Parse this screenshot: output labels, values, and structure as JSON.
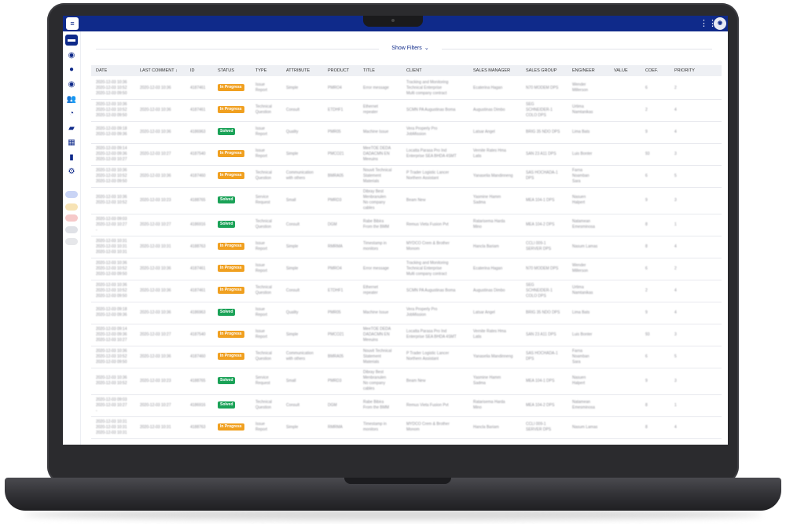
{
  "colors": {
    "brand": "#0f2a8a",
    "in_progress": "#f0a020",
    "solved": "#1aa257",
    "header_bg": "#eef0f4"
  },
  "topbar": {
    "logo_icon": "app-logo-icon",
    "apps_icon": "grid-apps-icon",
    "avatar_icon": "user-avatar"
  },
  "sidebar": {
    "items": [
      {
        "icon": "dashboard-icon",
        "active": true
      },
      {
        "icon": "eye-icon"
      },
      {
        "icon": "circle-icon"
      },
      {
        "icon": "eye-outline-icon"
      },
      {
        "icon": "users-icon"
      },
      {
        "icon": "clock-icon"
      },
      {
        "icon": "truck-icon"
      },
      {
        "icon": "qr-grid-icon"
      },
      {
        "icon": "document-icon"
      },
      {
        "icon": "settings-gear-icon"
      }
    ],
    "badges": [
      {
        "color": "#c9d4f5"
      },
      {
        "color": "#f7e3b5"
      },
      {
        "color": "#f6c9c9"
      },
      {
        "color": "#dfe1e6"
      },
      {
        "color": "#e6e7ea"
      }
    ]
  },
  "filters": {
    "label": "Show Filters"
  },
  "table": {
    "columns": [
      "DATE",
      "LAST COMMENT",
      "ID",
      "STATUS",
      "TYPE",
      "ATTRIBUTE",
      "PRODUCT",
      "TITLE",
      "CLIENT",
      "SALES MANAGER",
      "SALES GROUP",
      "ENGINEER",
      "VALUE",
      "COEF.",
      "PRIORITY"
    ],
    "sort_indicator": "↓",
    "rows": [
      {
        "date": "2020-12-03 10:36\n2020-12-03 10:52\n2020-12-03 09:50",
        "last": "2020-12-03 10:36",
        "id": "4187461",
        "status": "In Progress",
        "type": "Issue\nReport",
        "attr": "Simple",
        "product": "PMRO4",
        "title": "Error message",
        "client": "Tracking and Monitoring\nTechnical Enterprise\nMulti company contract",
        "sm": "Ecaterina Hagan",
        "sg": "N70 MODEM DPS",
        "eng": "Wender\nMillerson",
        "value": "",
        "coef": "6",
        "prio": "2"
      },
      {
        "date": "2020-12-03 10:36\n2020-12-03 10:52\n2020-12-03 09:50",
        "last": "2020-12-03 10:36",
        "id": "4187461",
        "status": "In Progress",
        "type": "Technical\nQuestion",
        "attr": "Consult",
        "product": "ETDHF1",
        "title": "Ethernet\nrepeater",
        "client": "SCMN PA Augustinas Boma",
        "sm": "Augustinas Dimbo",
        "sg": "SEG\nSCHNEIDER-1\nCOLO DPS",
        "eng": "Urtima\nNamtanikas",
        "value": "",
        "coef": "2",
        "prio": "4"
      },
      {
        "date": "2020-12-03 09:18\n2020-12-03 09:36",
        "last": "2020-12-03 10:36",
        "id": "4186963",
        "status": "Solved",
        "type": "Issue\nReport",
        "attr": "Quality",
        "product": "PMR05",
        "title": "Machine Issue",
        "client": "Vera Properly Pro\nJobMission",
        "sm": "Latsar Angel",
        "sg": "BRIG 35 NDO DPS",
        "eng": "Lima Bats",
        "value": "",
        "coef": "9",
        "prio": "4"
      },
      {
        "date": "2020-12-03 09:14\n2020-12-03 09:36\n2020-12-03 10:27",
        "last": "2020-12-03 10:27",
        "id": "4187540",
        "status": "In Progress",
        "type": "Issue\nReport",
        "attr": "Simple",
        "product": "PMCO21",
        "title": "MeeTOE DEDA\nDADACMN EN\nMeeuins",
        "client": "Locatta Parasa Pro Ind\nEnterprise SEA BHDA 4SMT",
        "sm": "Vernite Rates Hma\nLatis",
        "sg": "SAN 23 A11 DPS",
        "eng": "Luis Bonter",
        "value": "",
        "coef": "93",
        "prio": "3"
      },
      {
        "date": "2020-12-03 10:36\n2020-12-03 10:52\n2020-12-03 09:50",
        "last": "2020-12-03 10:36",
        "id": "4187460",
        "status": "In Progress",
        "type": "Technical\nQuestion",
        "attr": "Communication\nwith others",
        "product": "BMRA05",
        "title": "Nouvit Technical\nStatement\nMaterials",
        "client": "P Trader Logistic Lancer\nNorthern Assistant",
        "sm": "Yanaselia Mandinneng",
        "sg": "SAS HOCHADA-1\nDPS",
        "eng": "Farna\nNoamban\nSara",
        "value": "",
        "coef": "6",
        "prio": "5"
      },
      {
        "date": "2020-12-03 10:36\n2020-12-03 10:52",
        "last": "2020-12-03 10:23",
        "id": "4188765",
        "status": "Solved",
        "type": "Service\nRequest",
        "attr": "Small",
        "product": "PMRD3",
        "title": "Dibray Best\nMenbranulen\nNo company\ncables",
        "client": "Beam New",
        "sm": "Yasmine Hamm\nSadma",
        "sg": "MEA 104-1 DPS",
        "eng": "Nasuen\nHalpert",
        "value": "",
        "coef": "9",
        "prio": "3"
      },
      {
        "date": "2020-12-03 09:03\n2020-12-03 10:27\n-",
        "last": "2020-12-03 10:27",
        "id": "4186916",
        "status": "Solved",
        "type": "Technical\nQuestion",
        "attr": "Consult",
        "product": "DGM",
        "title": "Rabe Bibira\nFrom the BMM",
        "client": "Remus Vieta Fusion Pvt",
        "sm": "Ratarisema Harda\nMino",
        "sg": "MEA 104-2 DPS",
        "eng": "Natamean\nEmesminosa",
        "value": "",
        "coef": "8",
        "prio": "1"
      },
      {
        "date": "2020-12-03 10:31\n2020-12-03 10:31\n2020-12-03 10:31",
        "last": "2020-12-03 10:31",
        "id": "4188763",
        "status": "In Progress",
        "type": "Issue\nReport",
        "attr": "Simple",
        "product": "RMRMA",
        "title": "Timestamp in\nmonitors",
        "client": "MYDCO Crem & Brother\nMonom",
        "sm": "Hancla Bariam",
        "sg": "CCLI 009-1\nSERVER DPS",
        "eng": "Nasum Lamas",
        "value": "",
        "coef": "8",
        "prio": "4"
      },
      {
        "date": "2020-12-03 10:36\n2020-12-03 10:52\n2020-12-03 09:50",
        "last": "2020-12-03 10:36",
        "id": "4187461",
        "status": "In Progress",
        "type": "Issue\nReport",
        "attr": "Simple",
        "product": "PMRO4",
        "title": "Error message",
        "client": "Tracking and Monitoring\nTechnical Enterprise\nMulti company contract",
        "sm": "Ecaterina Hagan",
        "sg": "N70 MODEM DPS",
        "eng": "Wender\nMillerson",
        "value": "",
        "coef": "6",
        "prio": "2"
      },
      {
        "date": "2020-12-03 10:36\n2020-12-03 10:52\n2020-12-03 09:50",
        "last": "2020-12-03 10:36",
        "id": "4187461",
        "status": "In Progress",
        "type": "Technical\nQuestion",
        "attr": "Consult",
        "product": "ETDHF1",
        "title": "Ethernet\nrepeater",
        "client": "SCMN PA Augustinas Boma",
        "sm": "Augustinas Dimbo",
        "sg": "SEG\nSCHNEIDER-1\nCOLO DPS",
        "eng": "Urtima\nNamtanikas",
        "value": "",
        "coef": "2",
        "prio": "4"
      },
      {
        "date": "2020-12-03 09:18\n2020-12-03 09:36",
        "last": "2020-12-03 10:36",
        "id": "4186963",
        "status": "Solved",
        "type": "Issue\nReport",
        "attr": "Quality",
        "product": "PMR05",
        "title": "Machine Issue",
        "client": "Vera Properly Pro\nJobMission",
        "sm": "Latsar Angel",
        "sg": "BRIG 35 NDO DPS",
        "eng": "Lima Bats",
        "value": "",
        "coef": "9",
        "prio": "4"
      },
      {
        "date": "2020-12-03 09:14\n2020-12-03 09:36\n2020-12-03 10:27",
        "last": "2020-12-03 10:27",
        "id": "4187540",
        "status": "In Progress",
        "type": "Issue\nReport",
        "attr": "Simple",
        "product": "PMCO21",
        "title": "MeeTOE DEDA\nDADACMN EN\nMeeuins",
        "client": "Locatta Parasa Pro Ind\nEnterprise SEA BHDA 4SMT",
        "sm": "Vernite Rates Hma\nLatis",
        "sg": "SAN 23 A11 DPS",
        "eng": "Luis Bonter",
        "value": "",
        "coef": "93",
        "prio": "3"
      },
      {
        "date": "2020-12-03 10:36\n2020-12-03 10:52\n2020-12-03 09:50",
        "last": "2020-12-03 10:36",
        "id": "4187460",
        "status": "In Progress",
        "type": "Technical\nQuestion",
        "attr": "Communication\nwith others",
        "product": "BMRA05",
        "title": "Nouvit Technical\nStatement\nMaterials",
        "client": "P Trader Logistic Lancer\nNorthern Assistant",
        "sm": "Yanaselia Mandinneng",
        "sg": "SAS HOCHADA-1\nDPS",
        "eng": "Farna\nNoamban\nSara",
        "value": "",
        "coef": "6",
        "prio": "5"
      },
      {
        "date": "2020-12-03 10:36\n2020-12-03 10:52",
        "last": "2020-12-03 10:23",
        "id": "4188765",
        "status": "Solved",
        "type": "Service\nRequest",
        "attr": "Small",
        "product": "PMRD3",
        "title": "Dibray Best\nMenbranulen\nNo company\ncables",
        "client": "Beam New",
        "sm": "Yasmine Hamm\nSadma",
        "sg": "MEA 104-1 DPS",
        "eng": "Nasuen\nHalpert",
        "value": "",
        "coef": "9",
        "prio": "3"
      },
      {
        "date": "2020-12-03 09:03\n2020-12-03 10:27\n-",
        "last": "2020-12-03 10:27",
        "id": "4186916",
        "status": "Solved",
        "type": "Technical\nQuestion",
        "attr": "Consult",
        "product": "DGM",
        "title": "Rabe Bibira\nFrom the BMM",
        "client": "Remus Vieta Fusion Pvt",
        "sm": "Ratarisema Harda\nMino",
        "sg": "MEA 104-2 DPS",
        "eng": "Natamean\nEmesminosa",
        "value": "",
        "coef": "8",
        "prio": "1"
      },
      {
        "date": "2020-12-03 10:31\n2020-12-03 10:31\n2020-12-03 10:31",
        "last": "2020-12-03 10:31",
        "id": "4188763",
        "status": "In Progress",
        "type": "Issue\nReport",
        "attr": "Simple",
        "product": "RMRMA",
        "title": "Timestamp in\nmonitors",
        "client": "MYDCO Crem & Brother\nMonom",
        "sm": "Hancla Bariam",
        "sg": "CCLI 009-1\nSERVER DPS",
        "eng": "Nasum Lamas",
        "value": "",
        "coef": "8",
        "prio": "4"
      }
    ]
  }
}
